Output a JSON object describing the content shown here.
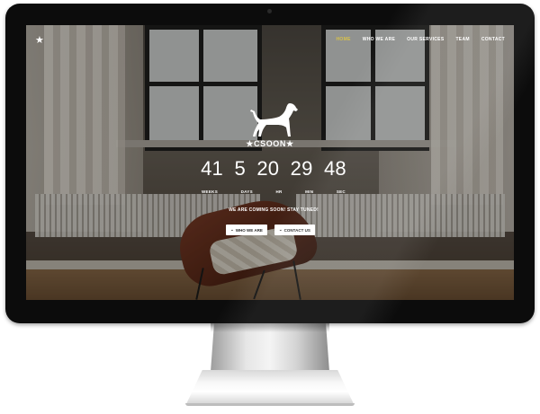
{
  "nav": {
    "logo_icon": "star-icon",
    "items": [
      {
        "label": "HOME",
        "active": true
      },
      {
        "label": "WHO WE ARE",
        "active": false
      },
      {
        "label": "OUR SERVICES",
        "active": false
      },
      {
        "label": "TEAM",
        "active": false
      },
      {
        "label": "CONTACT",
        "active": false
      }
    ]
  },
  "brand": {
    "name": "★CSOON★",
    "logo_icon": "dog-icon"
  },
  "countdown": {
    "values": [
      "41",
      "5",
      "20",
      "29",
      "48"
    ],
    "labels": [
      "WEEKS",
      "DAYS",
      "HR",
      "MIN",
      "SEC"
    ]
  },
  "tagline": "WE ARE COMING SOON! STAY TUNED!",
  "buttons": {
    "who_we_are": "WHO WE ARE",
    "contact_us": "CONTACT US"
  },
  "colors": {
    "accent": "#d9c248",
    "text": "#ffffff",
    "bezel": "#0c0c0c"
  }
}
